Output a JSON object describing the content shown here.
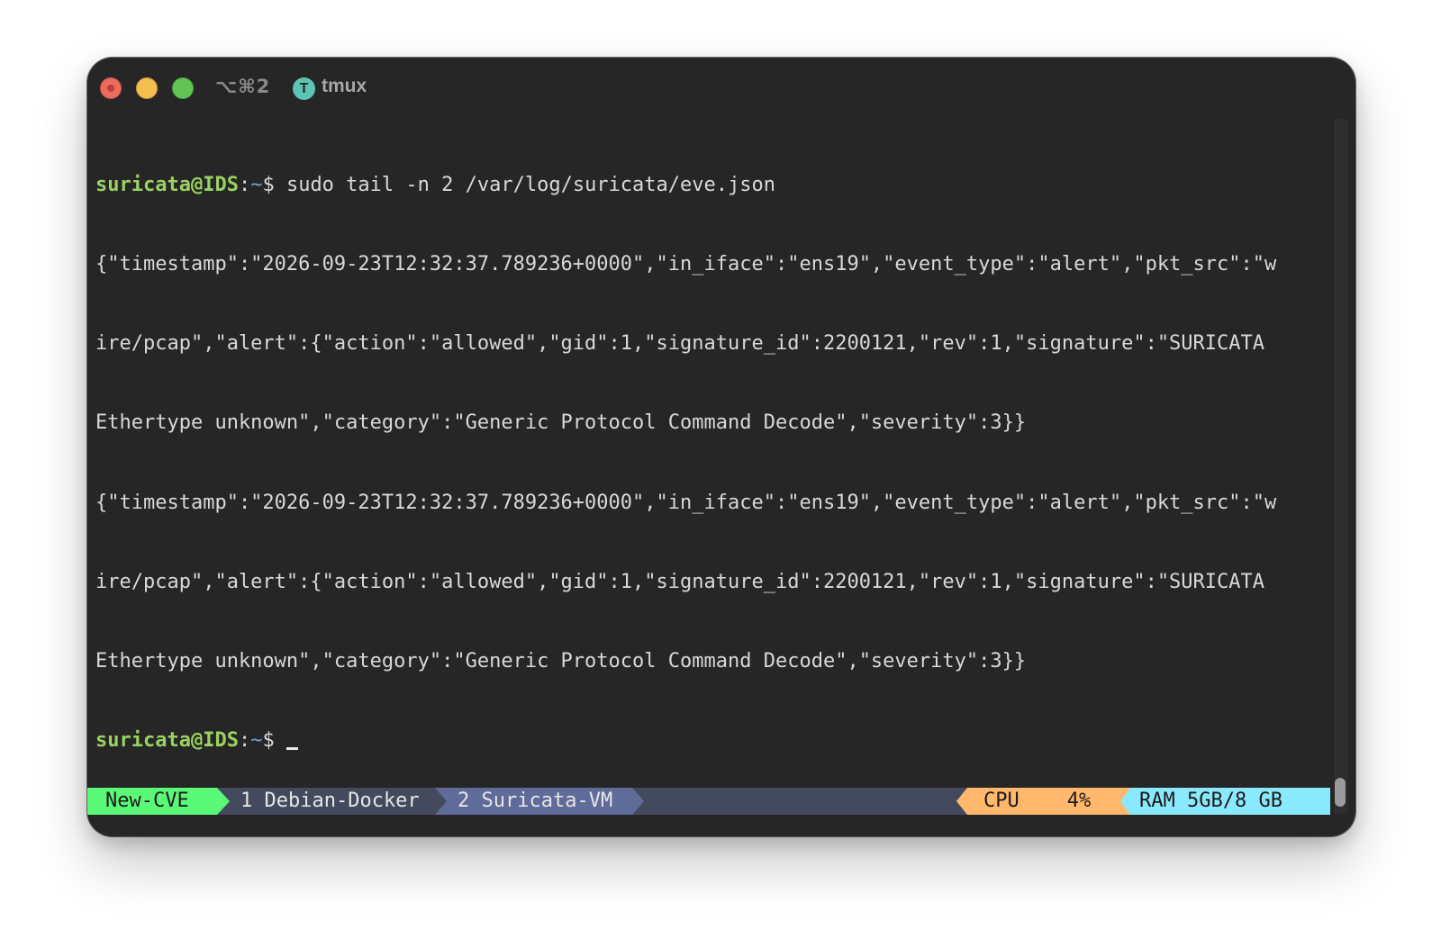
{
  "window": {
    "shortcut": "⌥⌘2",
    "app_icon_letter": "T",
    "app_name": "tmux"
  },
  "terminal": {
    "prompt": {
      "user_host": "suricata@IDS",
      "colon": ":",
      "path": "~",
      "symbol": "$"
    },
    "command": " sudo tail -n 2 /var/log/suricata/eve.json",
    "output_lines": [
      "{\"timestamp\":\"2026-09-23T12:32:37.789236+0000\",\"in_iface\":\"ens19\",\"event_type\":\"alert\",\"pkt_src\":\"w",
      "ire/pcap\",\"alert\":{\"action\":\"allowed\",\"gid\":1,\"signature_id\":2200121,\"rev\":1,\"signature\":\"SURICATA",
      "Ethertype unknown\",\"category\":\"Generic Protocol Command Decode\",\"severity\":3}}",
      "{\"timestamp\":\"2026-09-23T12:32:37.789236+0000\",\"in_iface\":\"ens19\",\"event_type\":\"alert\",\"pkt_src\":\"w",
      "ire/pcap\",\"alert\":{\"action\":\"allowed\",\"gid\":1,\"signature_id\":2200121,\"rev\":1,\"signature\":\"SURICATA",
      "Ethertype unknown\",\"category\":\"Generic Protocol Command Decode\",\"severity\":3}}"
    ]
  },
  "statusbar": {
    "session": "New-CVE",
    "windows": [
      "1 Debian-Docker",
      "2 Suricata-VM"
    ],
    "cpu": "CPU    4%",
    "ram": "RAM 5GB/8 GB"
  },
  "colors": {
    "session_bg": "#5af978",
    "active_window_bg": "#5f6b99",
    "cpu_bg": "#ffb86c",
    "ram_bg": "#8be9fd",
    "prompt_user": "#9ad261",
    "prompt_path": "#6fa3de"
  }
}
